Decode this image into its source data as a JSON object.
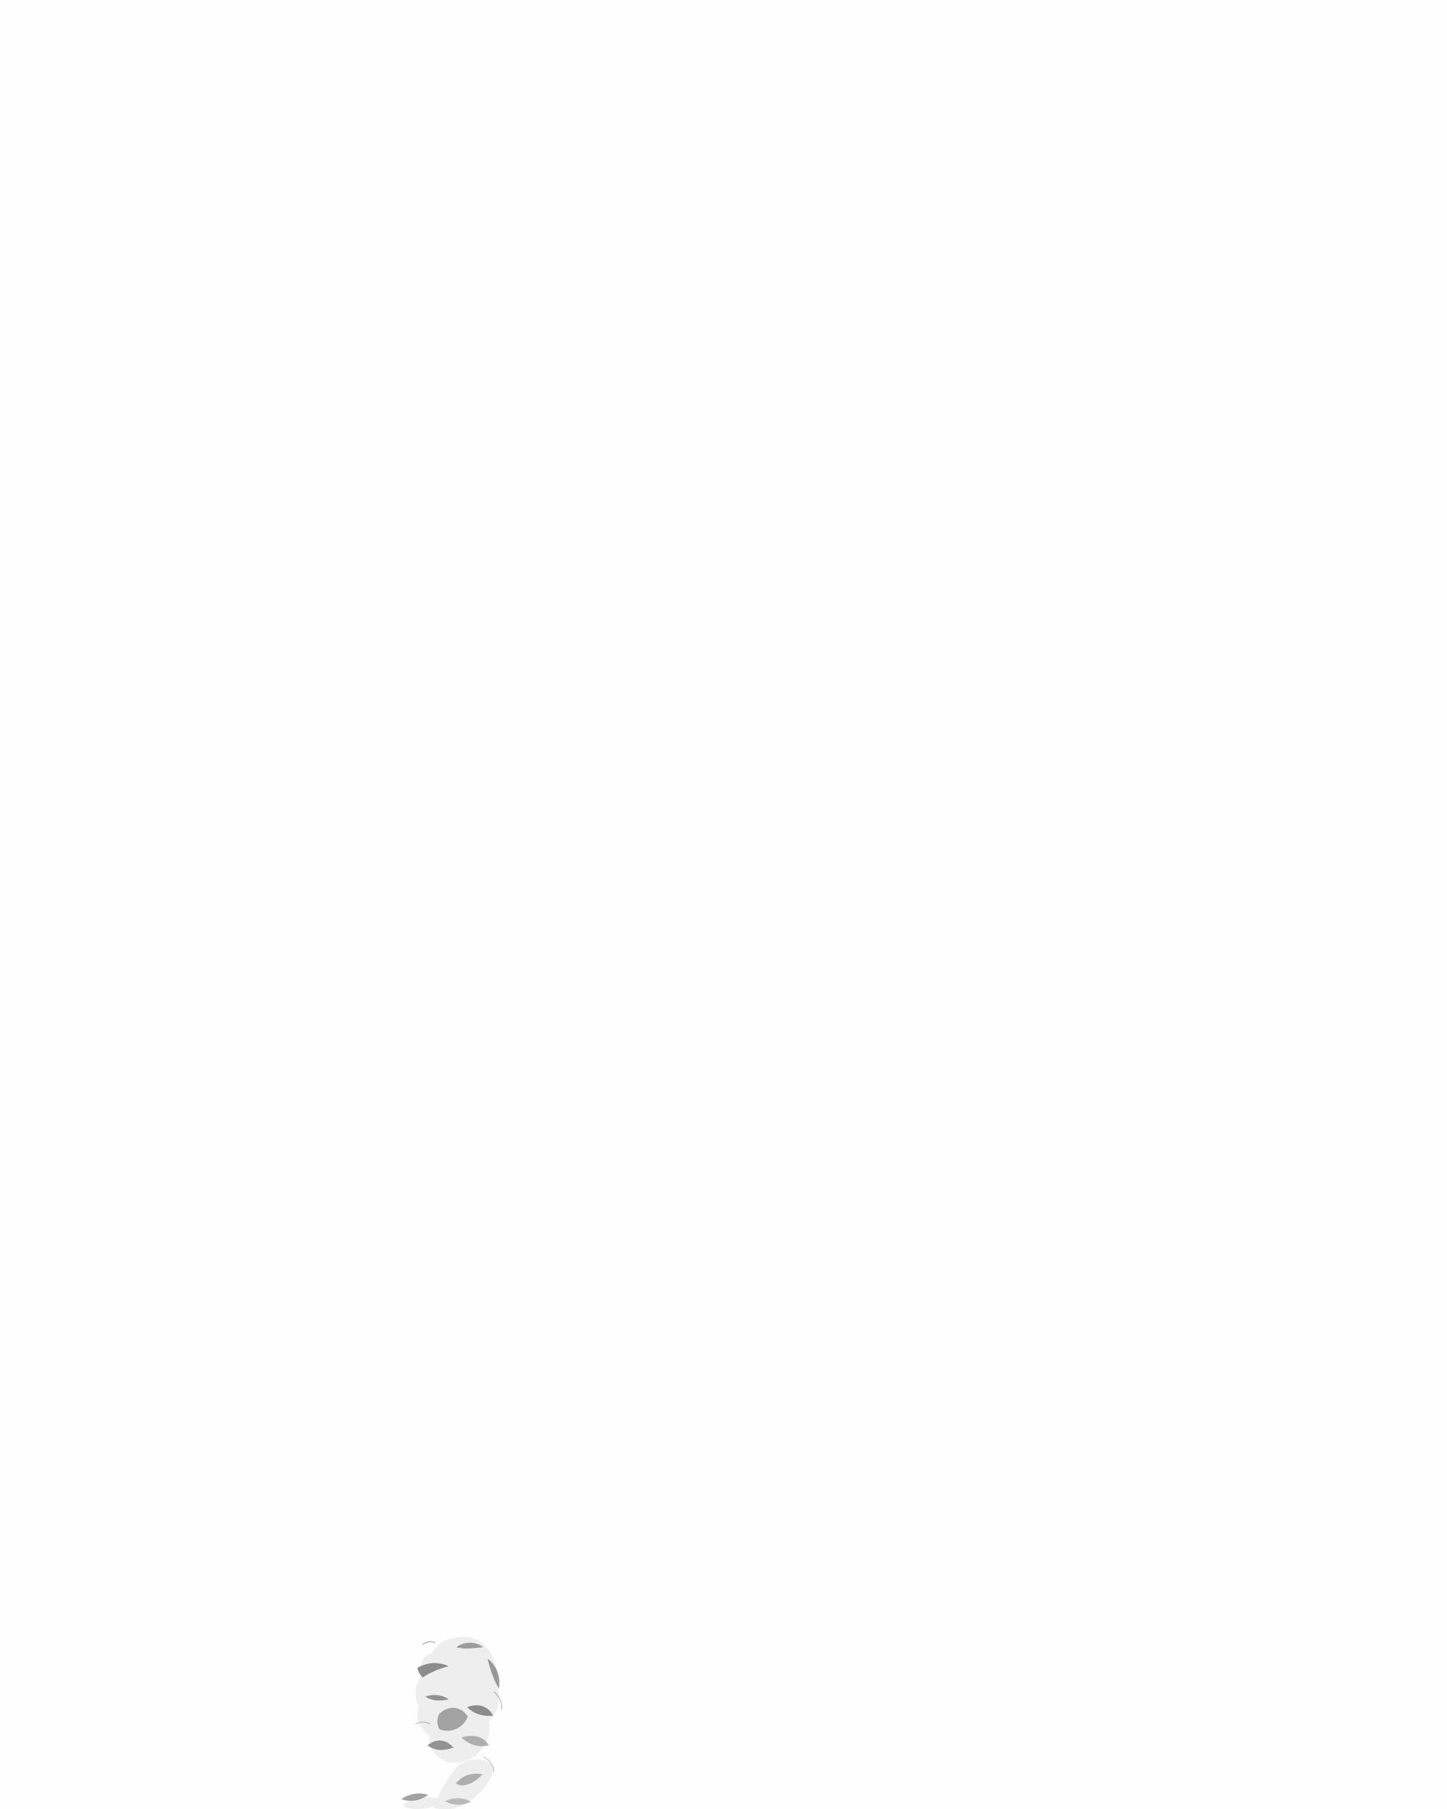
{
  "page": {
    "background_color": "#fefefe"
  },
  "image": {
    "subject_icon": "faded-portrait-fragment",
    "fill_color": "#eeeeee",
    "shadow_color": "#7a7a7a"
  }
}
